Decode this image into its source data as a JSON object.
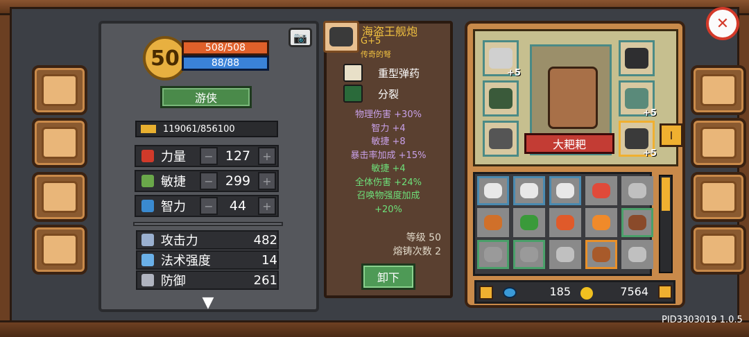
{
  "stats_panel": {
    "level": "50",
    "hp": "508/508",
    "mp": "88/88",
    "class_label": "游侠",
    "xp": "119061/856100",
    "attributes": [
      {
        "name": "力量",
        "value": "127",
        "icon": "fist-icon",
        "color": "#d03a2a"
      },
      {
        "name": "敏捷",
        "value": "299",
        "icon": "feather-icon",
        "color": "#6aa84a"
      },
      {
        "name": "智力",
        "value": "44",
        "icon": "book-icon",
        "color": "#3a8ad0"
      }
    ],
    "combat": [
      {
        "name": "攻击力",
        "value": "482",
        "icon": "sword-icon",
        "color": "#9ab0d0"
      },
      {
        "name": "法术强度",
        "value": "14",
        "icon": "wand-icon",
        "color": "#6ab0e8"
      },
      {
        "name": "防御",
        "value": "261",
        "icon": "shield-icon",
        "color": "#b0b4c0"
      }
    ]
  },
  "item_panel": {
    "name": "海盗王舰炮",
    "plus": "G+5",
    "rarity": "传奇的弩",
    "traits": [
      {
        "name": "重型弹药",
        "icon": "ammo-icon"
      },
      {
        "name": "分裂",
        "icon": "split-icon"
      }
    ],
    "bonuses": [
      {
        "text": "物理伤害 +30%",
        "green": false
      },
      {
        "text": "智力 +4",
        "green": false
      },
      {
        "text": "敏捷 +8",
        "green": false
      },
      {
        "text": "暴击率加成 +15%",
        "green": false
      },
      {
        "text": "敏捷 +4",
        "green": true
      },
      {
        "text": "全体伤害 +24%",
        "green": true
      },
      {
        "text": "召唤物强度加成",
        "green": true
      },
      {
        "text": "+20%",
        "green": true
      }
    ],
    "level_label": "等级 50",
    "forge_label": "熔铸次数 2",
    "unequip_label": "卸下"
  },
  "equip_panel": {
    "hero_name": "大耙耙",
    "tab_label": "I",
    "left_slots": [
      {
        "plus": "+5",
        "icon": "ring-icon"
      },
      {
        "plus": "",
        "icon": "amulet-icon"
      },
      {
        "plus": "",
        "icon": "gloves-icon"
      }
    ],
    "right_slots": [
      {
        "plus": "",
        "icon": "pet-cat-icon"
      },
      {
        "plus": "+5",
        "icon": "chest-armor-icon"
      },
      {
        "plus": "+5",
        "icon": "cannon-icon"
      }
    ],
    "inventory": [
      {
        "icon": "feather-icon",
        "color": "#e8e8e8",
        "border": "#4a8ab0"
      },
      {
        "icon": "feather-icon",
        "color": "#e8e8e8",
        "border": "#4a8ab0"
      },
      {
        "icon": "feather-icon",
        "color": "#e8e8e8",
        "border": "#4a8ab0"
      },
      {
        "icon": "potion-icon",
        "color": "#e04a3a",
        "border": "#8a8a8a"
      },
      {
        "icon": "stone-icon",
        "color": "#c0c0c0",
        "border": "#8a8a8a"
      },
      {
        "icon": "mushroom-icon",
        "color": "#d0702a",
        "border": "#8a8a8a"
      },
      {
        "icon": "leaf-icon",
        "color": "#3a9a3a",
        "border": "#8a8a8a"
      },
      {
        "icon": "maple-leaf-icon",
        "color": "#e05a2a",
        "border": "#8a8a8a"
      },
      {
        "icon": "carrot-icon",
        "color": "#f08a2a",
        "border": "#8a8a8a"
      },
      {
        "icon": "belt-icon",
        "color": "#8a4a2a",
        "border": "#4aa06a"
      },
      {
        "icon": "bow-icon",
        "color": "#9a9a9a",
        "border": "#4aa06a"
      },
      {
        "icon": "bow-icon",
        "color": "#9a9a9a",
        "border": "#4aa06a"
      },
      {
        "icon": "stone-icon",
        "color": "#c0c0c0",
        "border": "#8a8a8a"
      },
      {
        "icon": "belt-icon",
        "color": "#a85a2a",
        "border": "#e8902a"
      },
      {
        "icon": "armor-icon",
        "color": "#c0c0c0",
        "border": "#8a8a8a"
      }
    ],
    "gems": "185",
    "gold": "7564",
    "scroll_position": 0.0
  },
  "footer": {
    "pid": "PID3303019 1.0.5"
  },
  "side_menu": {
    "left": [
      "book-icon",
      "scroll-icon",
      "orb-icon",
      "helmet-icon"
    ],
    "right": [
      "hero-helmet-icon",
      "forge-icon",
      "skill-tree-icon",
      "settings-gear-icon"
    ]
  }
}
